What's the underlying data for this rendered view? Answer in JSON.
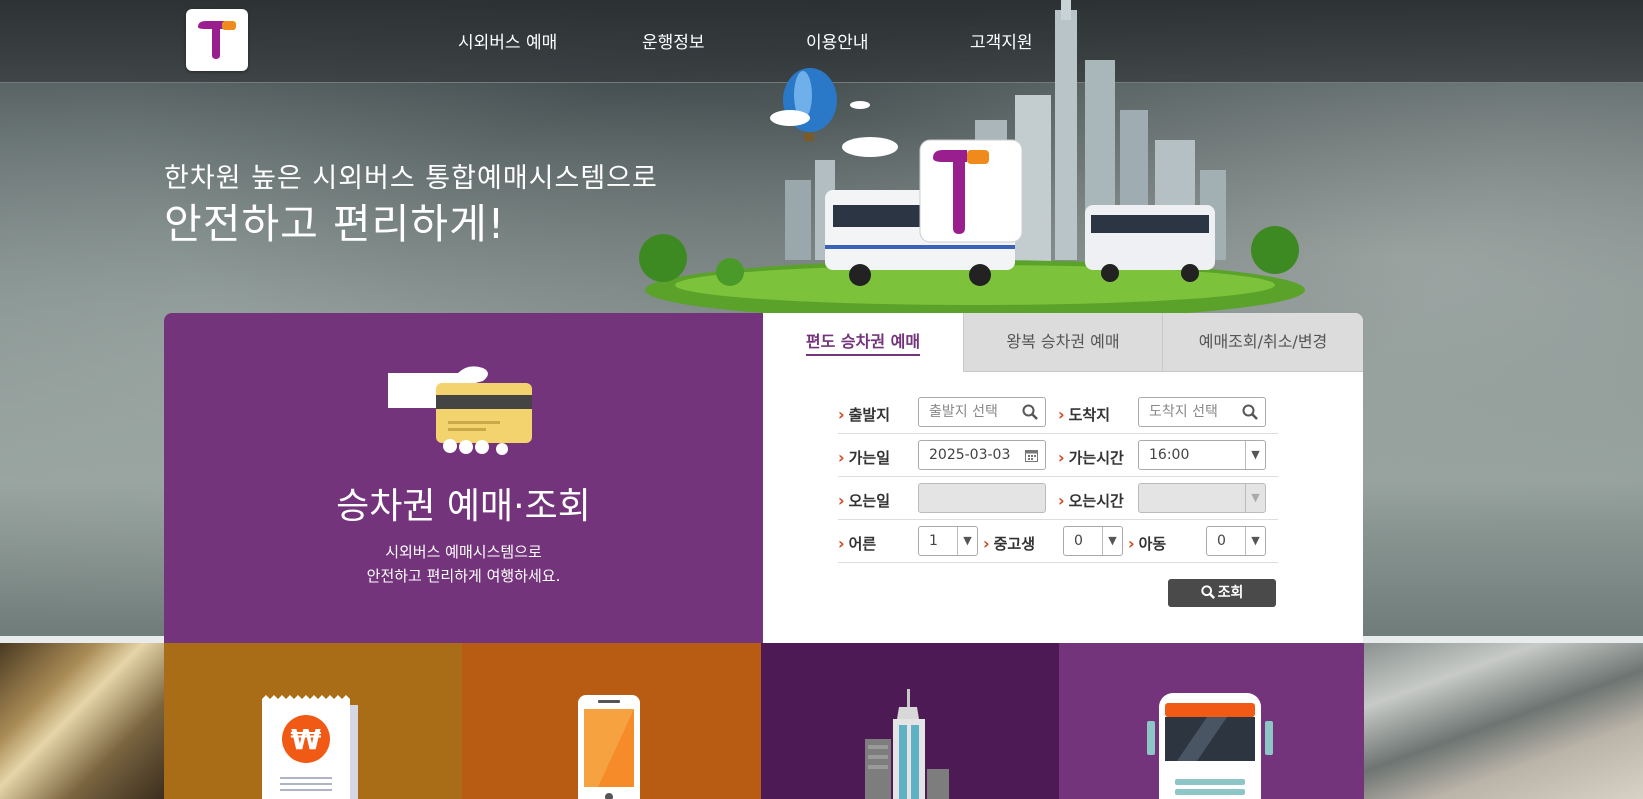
{
  "header": {
    "nav": [
      {
        "label": "시외버스 예매"
      },
      {
        "label": "운행정보"
      },
      {
        "label": "이용안내"
      },
      {
        "label": "고객지원"
      }
    ]
  },
  "hero": {
    "tagline_line1": "한차원 높은 시외버스 통합예매시스템으로",
    "tagline_line2": "안전하고 편리하게!"
  },
  "ticket_card": {
    "title": "승차권 예매·조회",
    "subtitle_line1": "시외버스 예매시스템으로",
    "subtitle_line2": "안전하고 편리하게 여행하세요."
  },
  "booking": {
    "tabs": [
      {
        "label": "편도 승차권 예매",
        "active": true
      },
      {
        "label": "왕복 승차권 예매",
        "active": false
      },
      {
        "label": "예매조회/취소/변경",
        "active": false
      }
    ],
    "departure_label": "출발지",
    "departure_placeholder": "출발지 선택",
    "arrival_label": "도착지",
    "arrival_placeholder": "도착지 선택",
    "go_date_label": "가는일",
    "go_date_value": "2025-03-03",
    "go_time_label": "가는시간",
    "go_time_value": "16:00",
    "return_date_label": "오는일",
    "return_time_label": "오는시간",
    "adult_label": "어른",
    "adult_value": "1",
    "youth_label": "중고생",
    "youth_value": "0",
    "child_label": "아동",
    "child_value": "0",
    "search_label": "조회"
  },
  "colors": {
    "brand_purple": "#74347c",
    "accent_orange": "#f08a1c",
    "tile_gold": "#a86d16",
    "tile_orange": "#b85c14",
    "tile_dark_purple": "#4e1a55",
    "tile_purple": "#74347c"
  },
  "icons": [
    "search-icon",
    "calendar-icon",
    "chevron-down-icon",
    "won-receipt-icon",
    "smartphone-icon",
    "building-icon",
    "bus-icon",
    "ticket-hand-icon"
  ]
}
